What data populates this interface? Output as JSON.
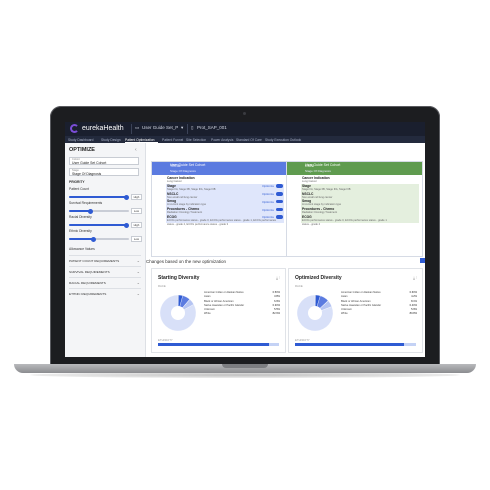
{
  "app": {
    "name": "eurekaHealth"
  },
  "topbar": {
    "tabs": [
      "User Guide Set_P",
      "Prot_SAP_001"
    ]
  },
  "subnav": {
    "items": [
      "Study Dashboard",
      "Study Design",
      "Patient Optimization",
      "Patient Funnel",
      "Site Selection",
      "Power Analysis",
      "Standard Of Care",
      "Study Execution Outlook"
    ],
    "active_index": 2
  },
  "sidebar": {
    "title": "OPTIMIZE",
    "fields": [
      {
        "label": "Cohort",
        "value": "User Guide Set Cohort"
      },
      {
        "label": "Stage",
        "value": "Stage Of Diagnosis"
      }
    ],
    "priority_label": "PRIORITY",
    "sliders": [
      {
        "label": "Patient Count",
        "level": 0.95,
        "pill": "High"
      },
      {
        "label": "Survival Requirements",
        "level": 0.35,
        "pill": "Low"
      },
      {
        "label": "Racial Diversity",
        "level": 0.95,
        "pill": "High"
      },
      {
        "label": "Ethnic Diversity",
        "level": 0.4,
        "pill": "Low"
      }
    ],
    "allowances_label": "Allowance Values",
    "sections": [
      "PATIENT COUNT REQUIREMENTS",
      "SURVIVAL REQUIREMENTS",
      "RACIAL REQUIREMENTS",
      "ETHNIC REQUIREMENTS"
    ]
  },
  "panels": [
    {
      "header_title": "User Guide Set Cohort",
      "header_label": "TOTAL",
      "header_sub": "Stage Of Diagnosis",
      "color": "#5b7be0",
      "rows": [
        {
          "title": "Cancer Indication",
          "sub": "Lung Cancer",
          "hl": false,
          "optimize": false
        },
        {
          "title": "Stage",
          "sub": "Stage IIA, Stage IIB, Stage IIIA, Stage IIIB",
          "hl": true,
          "optimize": true
        },
        {
          "title": "NSCLC",
          "sub": "Non-small cell lung cancer",
          "hl": true,
          "optimize": true
        },
        {
          "title": "Smog",
          "sub": "At current stage by indication type",
          "hl": true,
          "optimize": true
        },
        {
          "title": "Procedures - Chemo",
          "sub": "Radiation Oncology Treatment",
          "hl": true,
          "optimize": true
        },
        {
          "title": "ECOG",
          "sub": "ECOG performance status - grade 0, ECOG performance status - grade 1, ECOG performance",
          "hl": true,
          "optimize": true
        },
        {
          "title": "",
          "sub": "status - grade 2, ECOG performance status - grade 3",
          "hl": false,
          "optimize": false
        }
      ]
    },
    {
      "header_title": "User Guide Set Cohort",
      "header_label": "OMNI",
      "header_sub": "Stage Of Diagnosis",
      "color": "#5f9b4f",
      "rows": [
        {
          "title": "Cancer Indication",
          "sub": "Lung Cancer",
          "hl": false,
          "optimize": false
        },
        {
          "title": "Stage",
          "sub": "Stage IIA, Stage IIB, Stage IIIA, Stage IIIB",
          "hl": true,
          "optimize": false
        },
        {
          "title": "NSCLC",
          "sub": "Non-small cell lung cancer",
          "hl": true,
          "optimize": false
        },
        {
          "title": "Smog",
          "sub": "At current stage by indication type",
          "hl": true,
          "optimize": false
        },
        {
          "title": "Procedures - Chemo",
          "sub": "Radiation Oncology Treatment",
          "hl": true,
          "optimize": false
        },
        {
          "title": "ECOG",
          "sub": "ECOG performance status - grade 0, ECOG performance status - grade 1",
          "hl": true,
          "optimize": false
        },
        {
          "title": "",
          "sub": "status - grade 2",
          "hl": false,
          "optimize": false
        }
      ]
    }
  ],
  "optimize_label": "Optimize",
  "changes_title": "Changes based on the new optimization",
  "cards": [
    {
      "title": "Starting Diversity",
      "sub": "RACE",
      "bottom_label": "ETHNICITY",
      "bar_level": 0.92,
      "slices": [
        {
          "label": "American Indian or Alaskan Native",
          "value": 0.5,
          "display": "0.50%",
          "color": "#1f3f99"
        },
        {
          "label": "Asian",
          "value": 3.8,
          "display": "3.8%",
          "color": "#2f5bd3"
        },
        {
          "label": "Black or African American",
          "value": 6.9,
          "display": "6.9%",
          "color": "#5b7be0"
        },
        {
          "label": "Native Hawaiian or Pacific Islander",
          "value": 0.3,
          "display": "0.30%",
          "color": "#8aa2ea"
        },
        {
          "label": "Unknown",
          "value": 5.5,
          "display": "5.5%",
          "color": "#b5c4f2"
        },
        {
          "label": "White",
          "value": 82.9,
          "display": "82.9%",
          "color": "#d8e0f8"
        }
      ]
    },
    {
      "title": "Optimized Diversity",
      "sub": "RACE",
      "bottom_label": "ETHNICITY",
      "bar_level": 0.9,
      "slices": [
        {
          "label": "American Indian or Alaskan Native",
          "value": 0.6,
          "display": "0.60%",
          "color": "#1f3f99"
        },
        {
          "label": "Asian",
          "value": 4.2,
          "display": "4.2%",
          "color": "#2f5bd3"
        },
        {
          "label": "Black or African American",
          "value": 8.1,
          "display": "8.1%",
          "color": "#5b7be0"
        },
        {
          "label": "Native Hawaiian or Pacific Islander",
          "value": 0.4,
          "display": "0.40%",
          "color": "#8aa2ea"
        },
        {
          "label": "Unknown",
          "value": 5.9,
          "display": "5.9%",
          "color": "#b5c4f2"
        },
        {
          "label": "White",
          "value": 80.8,
          "display": "80.8%",
          "color": "#d8e0f8"
        }
      ]
    }
  ]
}
